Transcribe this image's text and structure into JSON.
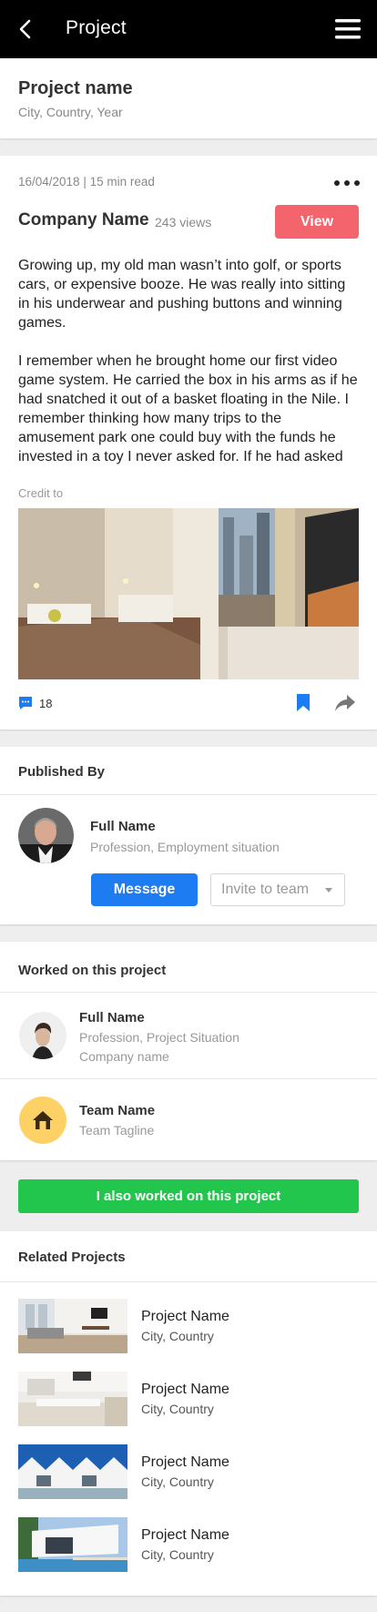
{
  "topbar": {
    "title": "Project"
  },
  "project": {
    "name": "Project name",
    "location": "City, Country, Year"
  },
  "article": {
    "meta": "16/04/2018 | 15 min read",
    "company": "Company Name",
    "views": "243 views",
    "view_label": "View",
    "paragraph1": "Growing up, my old man wasn’t into golf, or sports cars, or expensive booze. He was really into sitting in his underwear and pushing buttons and winning games.",
    "paragraph2": "I remember when he brought home our first video game system. He carried the box in his arms as if he had snatched it out of a basket floating in the Nile. I remember thinking how many trips to the amusement park one could buy with the funds he invested in a toy I never asked for. If he had asked",
    "credit": "Credit to",
    "comments_count": "18"
  },
  "published": {
    "title": "Published By",
    "name": "Full Name",
    "profession": "Profession, Employment situation",
    "message_label": "Message",
    "invite_placeholder": "Invite to team"
  },
  "worked": {
    "title": "Worked on this project",
    "person": {
      "name": "Full Name",
      "profession": "Profession, Project Situation",
      "company": "Company name"
    },
    "team": {
      "name": "Team Name",
      "tagline": "Team Tagline"
    },
    "button_label": "I also worked on this project"
  },
  "related": {
    "title": "Related Projects",
    "items": [
      {
        "name": "Project Name",
        "location": "City, Country"
      },
      {
        "name": "Project Name",
        "location": "City, Country"
      },
      {
        "name": "Project Name",
        "location": "City, Country"
      },
      {
        "name": "Project Name",
        "location": "City, Country"
      }
    ]
  },
  "colors": {
    "view": "#f4646c",
    "message": "#1e7cf2",
    "worked": "#22c64d",
    "team_icon_bg": "#fdd165",
    "topbar": "#000000"
  }
}
